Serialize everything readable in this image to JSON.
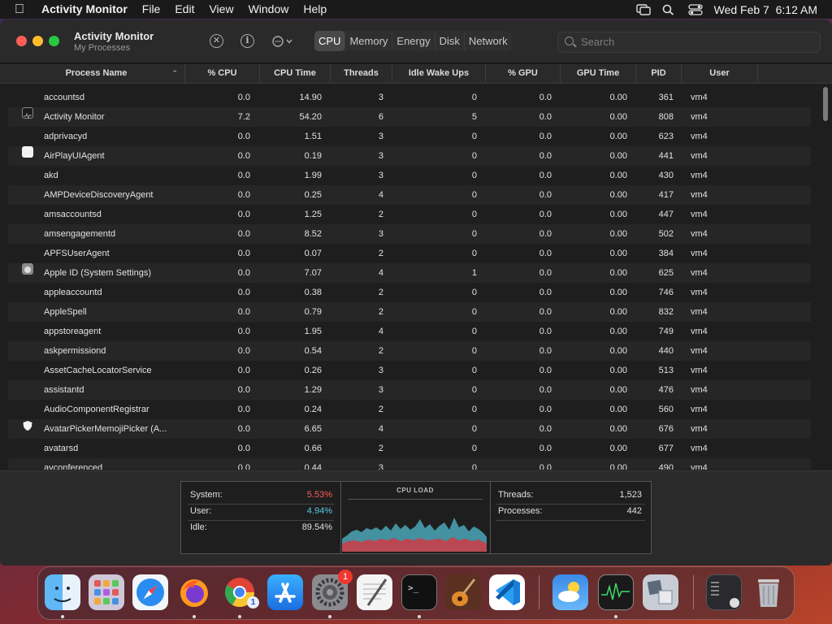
{
  "menubar": {
    "app_name": "Activity Monitor",
    "items": [
      "File",
      "Edit",
      "View",
      "Window",
      "Help"
    ],
    "datetime": "Wed Feb 7  6:12 AM"
  },
  "window": {
    "title": "Activity Monitor",
    "subtitle": "My Processes",
    "tabs": [
      {
        "label": "CPU",
        "active": true
      },
      {
        "label": "Memory",
        "active": false
      },
      {
        "label": "Energy",
        "active": false
      },
      {
        "label": "Disk",
        "active": false
      },
      {
        "label": "Network",
        "active": false
      }
    ],
    "search_placeholder": "Search"
  },
  "table": {
    "columns": [
      "Process Name",
      "% CPU",
      "CPU Time",
      "Threads",
      "Idle Wake Ups",
      "% GPU",
      "GPU Time",
      "PID",
      "User"
    ],
    "rows": [
      {
        "name": "accountsd",
        "cpu": "0.0",
        "cpu_time": "14.90",
        "threads": "3",
        "idle": "0",
        "gpu": "0.0",
        "gpu_time": "0.00",
        "pid": "361",
        "user": "vm4",
        "icon": ""
      },
      {
        "name": "Activity Monitor",
        "cpu": "7.2",
        "cpu_time": "54.20",
        "threads": "6",
        "idle": "5",
        "gpu": "0.0",
        "gpu_time": "0.00",
        "pid": "808",
        "user": "vm4",
        "icon": "activity-monitor-icon"
      },
      {
        "name": "adprivacyd",
        "cpu": "0.0",
        "cpu_time": "1.51",
        "threads": "3",
        "idle": "0",
        "gpu": "0.0",
        "gpu_time": "0.00",
        "pid": "623",
        "user": "vm4",
        "icon": ""
      },
      {
        "name": "AirPlayUIAgent",
        "cpu": "0.0",
        "cpu_time": "0.19",
        "threads": "3",
        "idle": "0",
        "gpu": "0.0",
        "gpu_time": "0.00",
        "pid": "441",
        "user": "vm4",
        "icon": "generic-app-icon"
      },
      {
        "name": "akd",
        "cpu": "0.0",
        "cpu_time": "1.99",
        "threads": "3",
        "idle": "0",
        "gpu": "0.0",
        "gpu_time": "0.00",
        "pid": "430",
        "user": "vm4",
        "icon": ""
      },
      {
        "name": "AMPDeviceDiscoveryAgent",
        "cpu": "0.0",
        "cpu_time": "0.25",
        "threads": "4",
        "idle": "0",
        "gpu": "0.0",
        "gpu_time": "0.00",
        "pid": "417",
        "user": "vm4",
        "icon": ""
      },
      {
        "name": "amsaccountsd",
        "cpu": "0.0",
        "cpu_time": "1.25",
        "threads": "2",
        "idle": "0",
        "gpu": "0.0",
        "gpu_time": "0.00",
        "pid": "447",
        "user": "vm4",
        "icon": ""
      },
      {
        "name": "amsengagementd",
        "cpu": "0.0",
        "cpu_time": "8.52",
        "threads": "3",
        "idle": "0",
        "gpu": "0.0",
        "gpu_time": "0.00",
        "pid": "502",
        "user": "vm4",
        "icon": ""
      },
      {
        "name": "APFSUserAgent",
        "cpu": "0.0",
        "cpu_time": "0.07",
        "threads": "2",
        "idle": "0",
        "gpu": "0.0",
        "gpu_time": "0.00",
        "pid": "384",
        "user": "vm4",
        "icon": ""
      },
      {
        "name": "Apple ID (System Settings)",
        "cpu": "0.0",
        "cpu_time": "7.07",
        "threads": "4",
        "idle": "1",
        "gpu": "0.0",
        "gpu_time": "0.00",
        "pid": "625",
        "user": "vm4",
        "icon": "apple-id-icon"
      },
      {
        "name": "appleaccountd",
        "cpu": "0.0",
        "cpu_time": "0.38",
        "threads": "2",
        "idle": "0",
        "gpu": "0.0",
        "gpu_time": "0.00",
        "pid": "746",
        "user": "vm4",
        "icon": ""
      },
      {
        "name": "AppleSpell",
        "cpu": "0.0",
        "cpu_time": "0.79",
        "threads": "2",
        "idle": "0",
        "gpu": "0.0",
        "gpu_time": "0.00",
        "pid": "832",
        "user": "vm4",
        "icon": ""
      },
      {
        "name": "appstoreagent",
        "cpu": "0.0",
        "cpu_time": "1.95",
        "threads": "4",
        "idle": "0",
        "gpu": "0.0",
        "gpu_time": "0.00",
        "pid": "749",
        "user": "vm4",
        "icon": ""
      },
      {
        "name": "askpermissiond",
        "cpu": "0.0",
        "cpu_time": "0.54",
        "threads": "2",
        "idle": "0",
        "gpu": "0.0",
        "gpu_time": "0.00",
        "pid": "440",
        "user": "vm4",
        "icon": ""
      },
      {
        "name": "AssetCacheLocatorService",
        "cpu": "0.0",
        "cpu_time": "0.26",
        "threads": "3",
        "idle": "0",
        "gpu": "0.0",
        "gpu_time": "0.00",
        "pid": "513",
        "user": "vm4",
        "icon": ""
      },
      {
        "name": "assistantd",
        "cpu": "0.0",
        "cpu_time": "1.29",
        "threads": "3",
        "idle": "0",
        "gpu": "0.0",
        "gpu_time": "0.00",
        "pid": "476",
        "user": "vm4",
        "icon": ""
      },
      {
        "name": "AudioComponentRegistrar",
        "cpu": "0.0",
        "cpu_time": "0.24",
        "threads": "2",
        "idle": "0",
        "gpu": "0.0",
        "gpu_time": "0.00",
        "pid": "560",
        "user": "vm4",
        "icon": ""
      },
      {
        "name": "AvatarPickerMemojiPicker (A...",
        "cpu": "0.0",
        "cpu_time": "6.65",
        "threads": "4",
        "idle": "0",
        "gpu": "0.0",
        "gpu_time": "0.00",
        "pid": "676",
        "user": "vm4",
        "icon": "shield-icon"
      },
      {
        "name": "avatarsd",
        "cpu": "0.0",
        "cpu_time": "0.66",
        "threads": "2",
        "idle": "0",
        "gpu": "0.0",
        "gpu_time": "0.00",
        "pid": "677",
        "user": "vm4",
        "icon": ""
      },
      {
        "name": "avconferenced",
        "cpu": "0.0",
        "cpu_time": "0.44",
        "threads": "3",
        "idle": "0",
        "gpu": "0.0",
        "gpu_time": "0.00",
        "pid": "490",
        "user": "vm4",
        "icon": ""
      }
    ]
  },
  "stats": {
    "system_label": "System:",
    "system_value": "5.53%",
    "user_label": "User:",
    "user_value": "4.94%",
    "idle_label": "Idle:",
    "idle_value": "89.54%",
    "cpu_load_title": "CPU LOAD",
    "threads_label": "Threads:",
    "threads_value": "1,523",
    "processes_label": "Processes:",
    "processes_value": "442"
  },
  "colors": {
    "system": "#ff5a5a",
    "user": "#5ac8e6"
  },
  "dock": {
    "apps": [
      "finder-icon",
      "launchpad-icon",
      "safari-icon",
      "firefox-icon",
      "chrome-icon",
      "app-store-icon",
      "system-settings-icon",
      "textedit-icon",
      "terminal-icon",
      "garageband-icon",
      "vscode-icon",
      "weather-icon",
      "activity-monitor-icon",
      "migration-assistant-icon",
      "downloads-stack-icon",
      "trash-icon"
    ],
    "settings_badge": "1",
    "chrome_badge": "1"
  }
}
